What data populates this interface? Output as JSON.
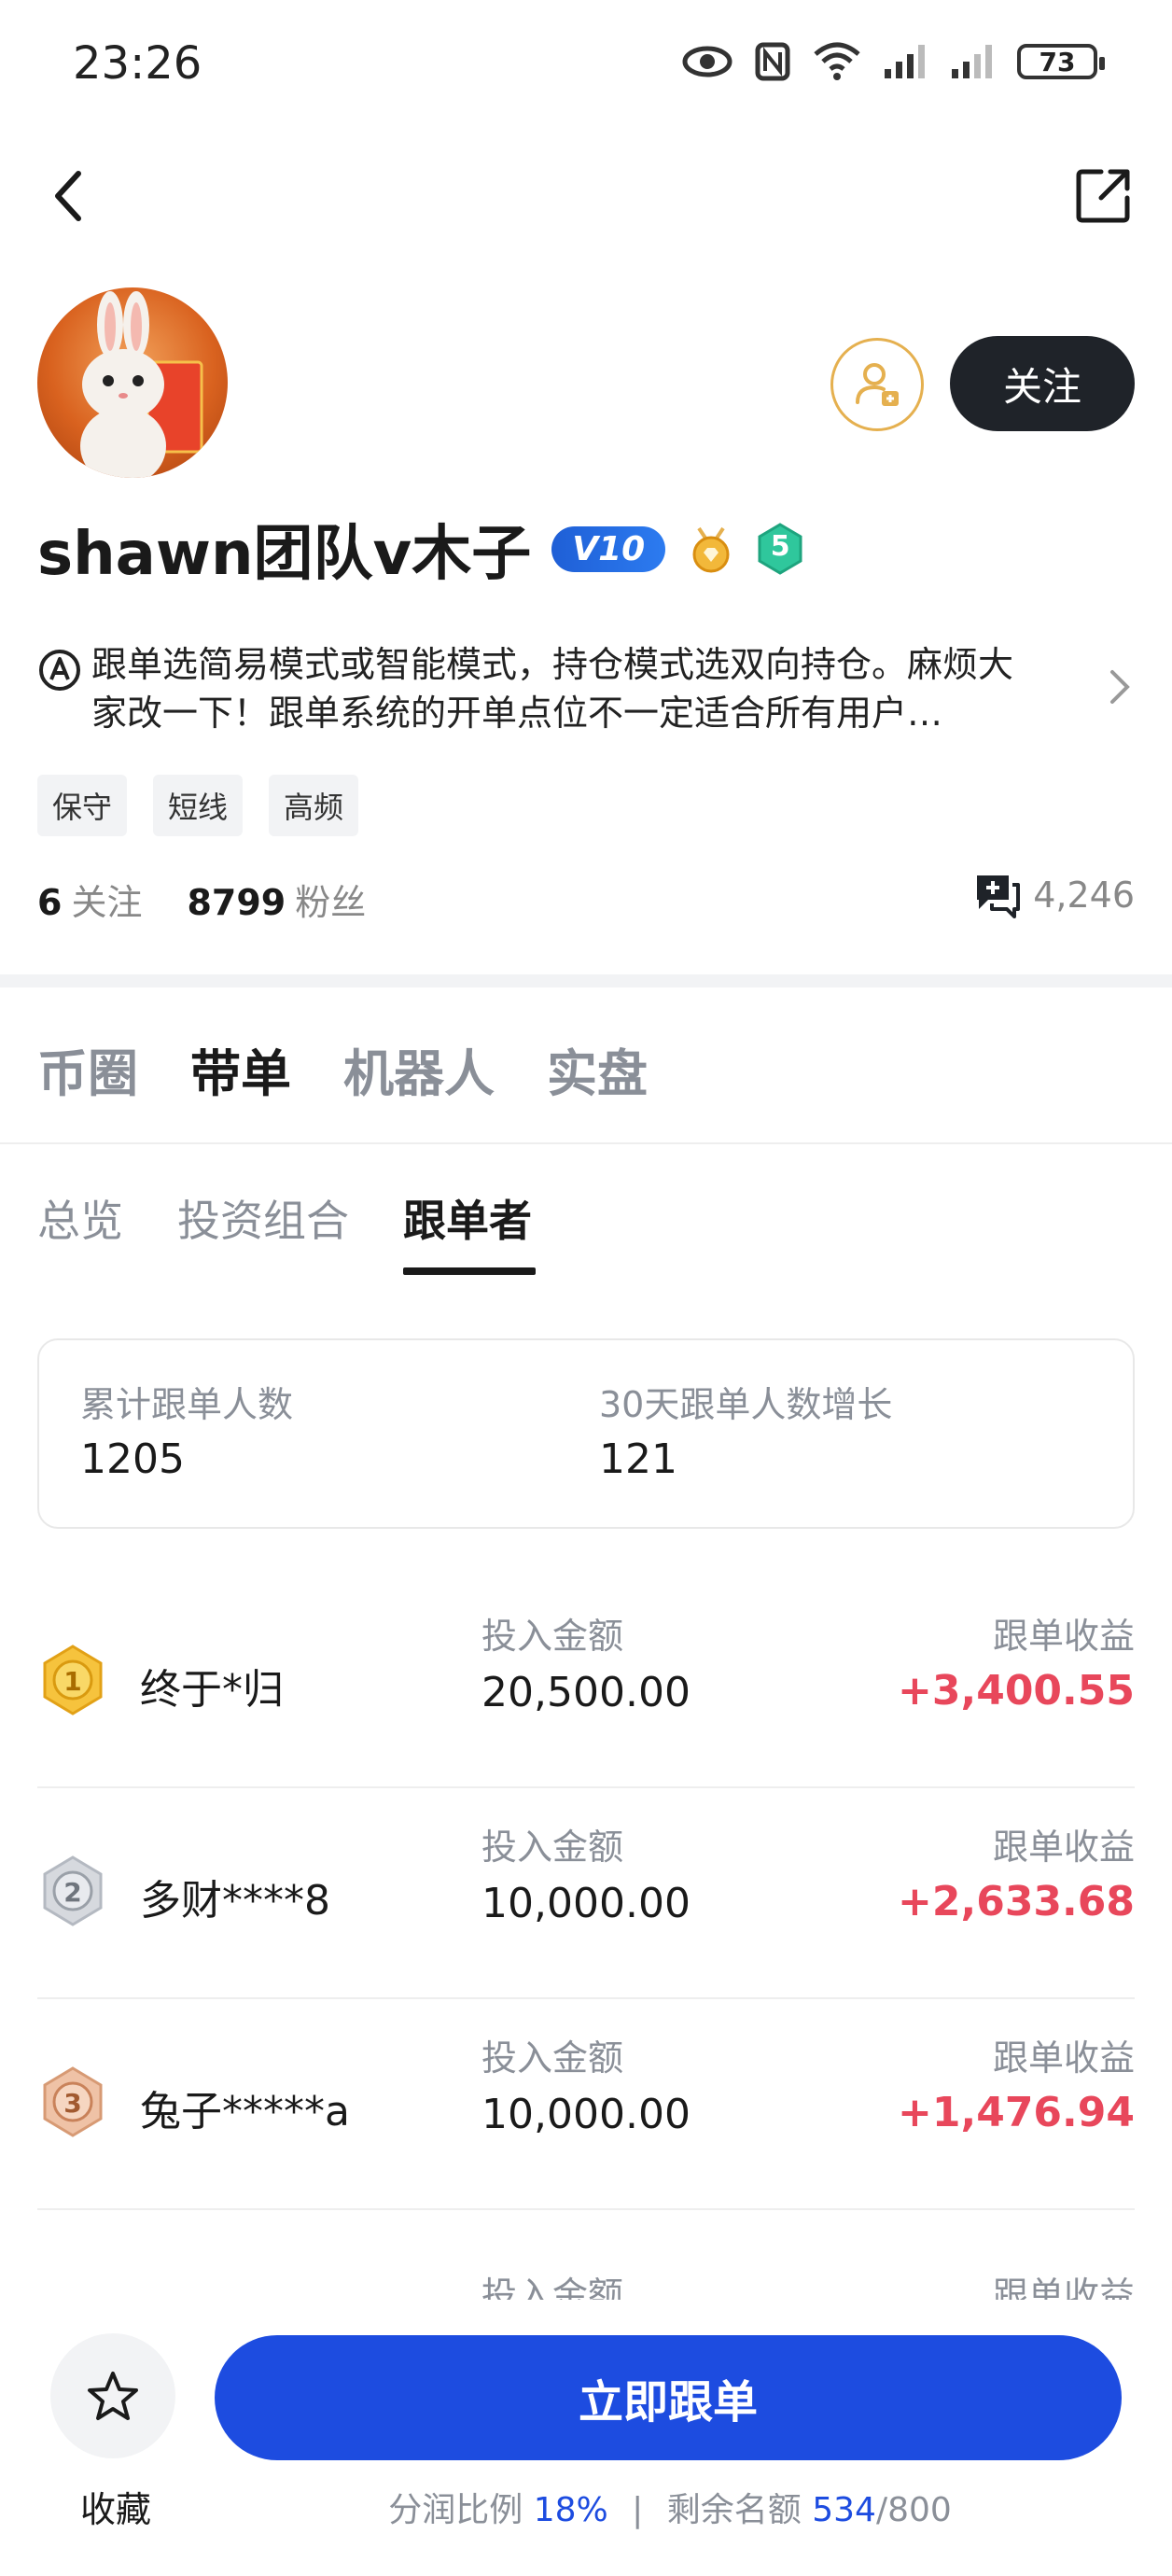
{
  "status_bar": {
    "time": "23:26",
    "battery": "73"
  },
  "profile": {
    "name": "shawn团队v木子",
    "vip_level": "V10",
    "level_badge": "5",
    "follow_label": "关注",
    "bio": "跟单选简易模式或智能模式，持仓模式选双向持仓。麻烦大家改一下！跟单系统的开单点位不一定适合所有用户…",
    "tags": [
      "保守",
      "短线",
      "高频"
    ],
    "following_count": "6",
    "following_label": "关注",
    "followers_count": "8799",
    "followers_label": "粉丝",
    "message_count": "4,246"
  },
  "main_tabs": [
    {
      "label": "币圈",
      "active": false
    },
    {
      "label": "带单",
      "active": true
    },
    {
      "label": "机器人",
      "active": false
    },
    {
      "label": "实盘",
      "active": false
    }
  ],
  "sub_tabs": [
    {
      "label": "总览",
      "active": false
    },
    {
      "label": "投资组合",
      "active": false
    },
    {
      "label": "跟单者",
      "active": true
    }
  ],
  "summary": {
    "total_label": "累计跟单人数",
    "total_value": "1205",
    "growth_label": "30天跟单人数增长",
    "growth_value": "121"
  },
  "followers": [
    {
      "rank": "1",
      "name": "终于*归",
      "amount_label": "投入金额",
      "amount": "20,500.00",
      "profit_label": "跟单收益",
      "profit": "+3,400.55"
    },
    {
      "rank": "2",
      "name": "多财****8",
      "amount_label": "投入金额",
      "amount": "10,000.00",
      "profit_label": "跟单收益",
      "profit": "+2,633.68"
    },
    {
      "rank": "3",
      "name": "兔子*****a",
      "amount_label": "投入金额",
      "amount": "10,000.00",
      "profit_label": "跟单收益",
      "profit": "+1,476.94"
    }
  ],
  "partial_row": {
    "amount_label": "投入金额",
    "profit_label": "跟单收益"
  },
  "bottom": {
    "favorite_label": "收藏",
    "cta_label": "立即跟单",
    "share_label": "分润比例",
    "share_value": "18%",
    "separator": "|",
    "remaining_label": "剩余名额",
    "remaining_value": "534",
    "remaining_total": "/800"
  },
  "colors": {
    "accent": "#1d4ce0",
    "profit": "#e8475b",
    "gold": "#e5b04f"
  }
}
